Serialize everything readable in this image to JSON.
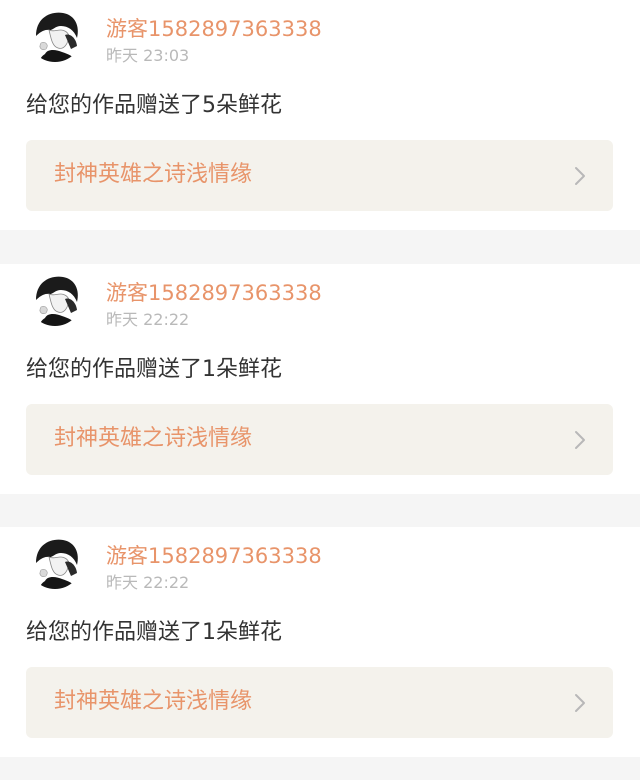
{
  "notifications": [
    {
      "username": "游客1582897363338",
      "timestamp": "昨天 23:03",
      "message": "给您的作品赠送了5朵鲜花",
      "work_title": "封神英雄之诗浅情缘"
    },
    {
      "username": "游客1582897363338",
      "timestamp": "昨天 22:22",
      "message": "给您的作品赠送了1朵鲜花",
      "work_title": "封神英雄之诗浅情缘"
    },
    {
      "username": "游客1582897363338",
      "timestamp": "昨天 22:22",
      "message": "给您的作品赠送了1朵鲜花",
      "work_title": "封神英雄之诗浅情缘"
    }
  ],
  "colors": {
    "accent": "#e8946a",
    "muted": "#b9b9b9",
    "text": "#333333",
    "link_background": "#f4f2ec",
    "divider": "#f5f5f5"
  },
  "icons": {
    "avatar": "avatar",
    "link_arrow": "chevron-right-icon"
  }
}
